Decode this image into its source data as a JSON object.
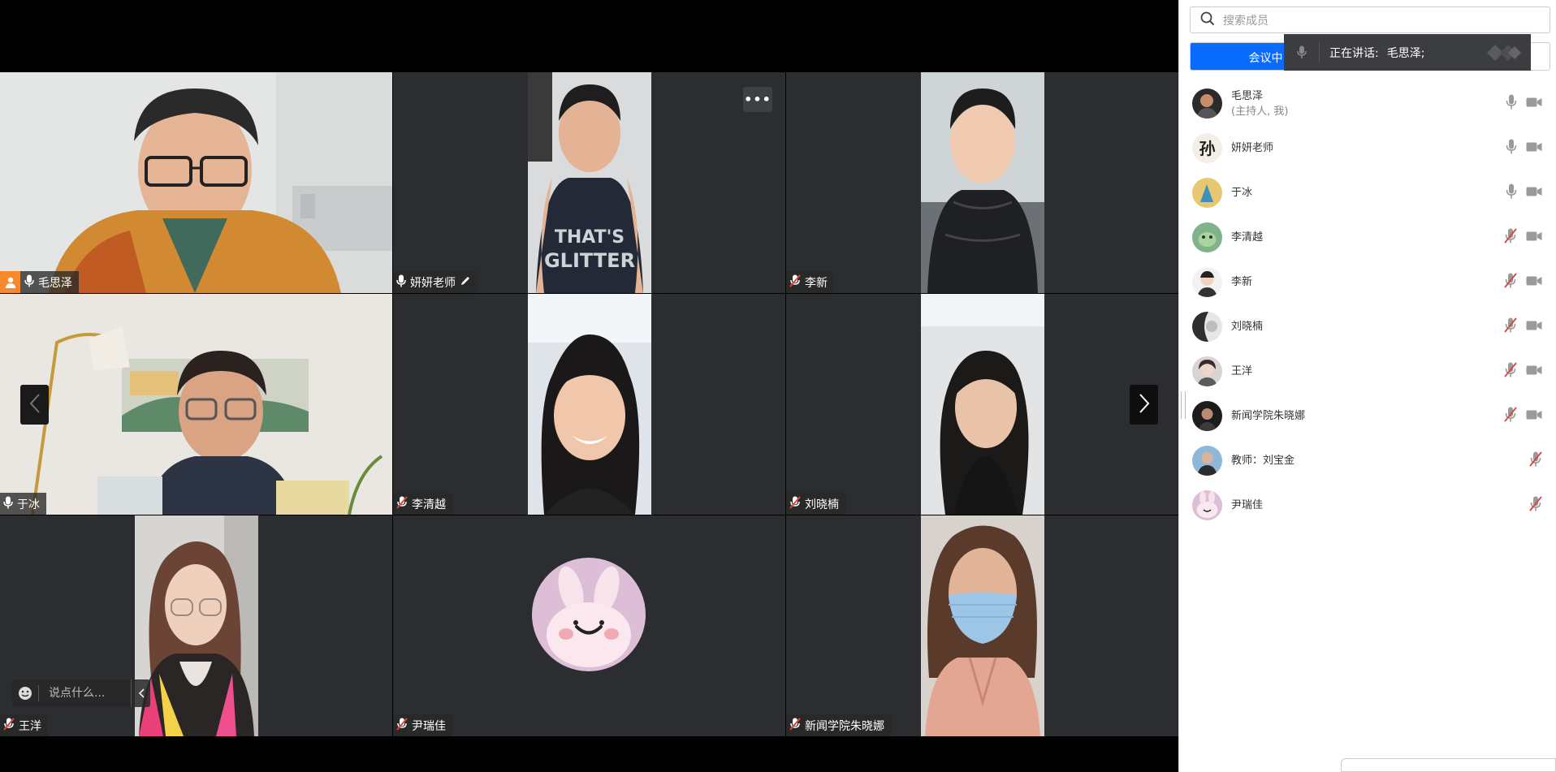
{
  "grid": {
    "tiles": [
      {
        "name": "毛思泽",
        "mic": "on",
        "host": true,
        "active": true
      },
      {
        "name": "妍妍老师",
        "mic": "on",
        "editing": true,
        "more_button": true
      },
      {
        "name": "李新",
        "mic": "muted"
      },
      {
        "name": "于冰",
        "mic": "on"
      },
      {
        "name": "李清越",
        "mic": "muted"
      },
      {
        "name": "刘晓楠",
        "mic": "muted"
      },
      {
        "name": "王洋",
        "mic": "muted"
      },
      {
        "name": "尹瑞佳",
        "mic": "muted",
        "avatar_only": true
      },
      {
        "name": "新闻学院朱晓娜",
        "mic": "muted"
      }
    ],
    "nav": {
      "prev_icon": "chevron-left-icon",
      "next_icon": "chevron-right-icon"
    },
    "more_icon": "more-icon"
  },
  "chat": {
    "placeholder": "说点什么..."
  },
  "panel": {
    "search_placeholder": "搜索成员",
    "meeting_button_label": "会议中",
    "speaking_label": "正在讲话:",
    "speaking_name": "毛思泽;",
    "participants": [
      {
        "name": "毛思泽",
        "sub": "(主持人, 我)",
        "mic": "on",
        "video": "on"
      },
      {
        "name": "妍妍老师",
        "mic": "on",
        "video": "on"
      },
      {
        "name": "于冰",
        "mic": "on",
        "video": "on"
      },
      {
        "name": "李清越",
        "mic": "muted",
        "video": "on"
      },
      {
        "name": "李新",
        "mic": "muted",
        "video": "on"
      },
      {
        "name": "刘晓楠",
        "mic": "muted",
        "video": "on"
      },
      {
        "name": "王洋",
        "mic": "muted",
        "video": "on"
      },
      {
        "name": "新闻学院朱晓娜",
        "mic": "muted",
        "video": "on"
      },
      {
        "name": "教师：刘宝金",
        "mic": "muted",
        "video": "none"
      },
      {
        "name": "尹瑞佳",
        "mic": "muted",
        "video": "none"
      }
    ]
  },
  "colors": {
    "active_border": "#1fbf5b",
    "host_badge": "#f7892c",
    "primary": "#0a6cff",
    "muted_mic": "#d4463f"
  }
}
